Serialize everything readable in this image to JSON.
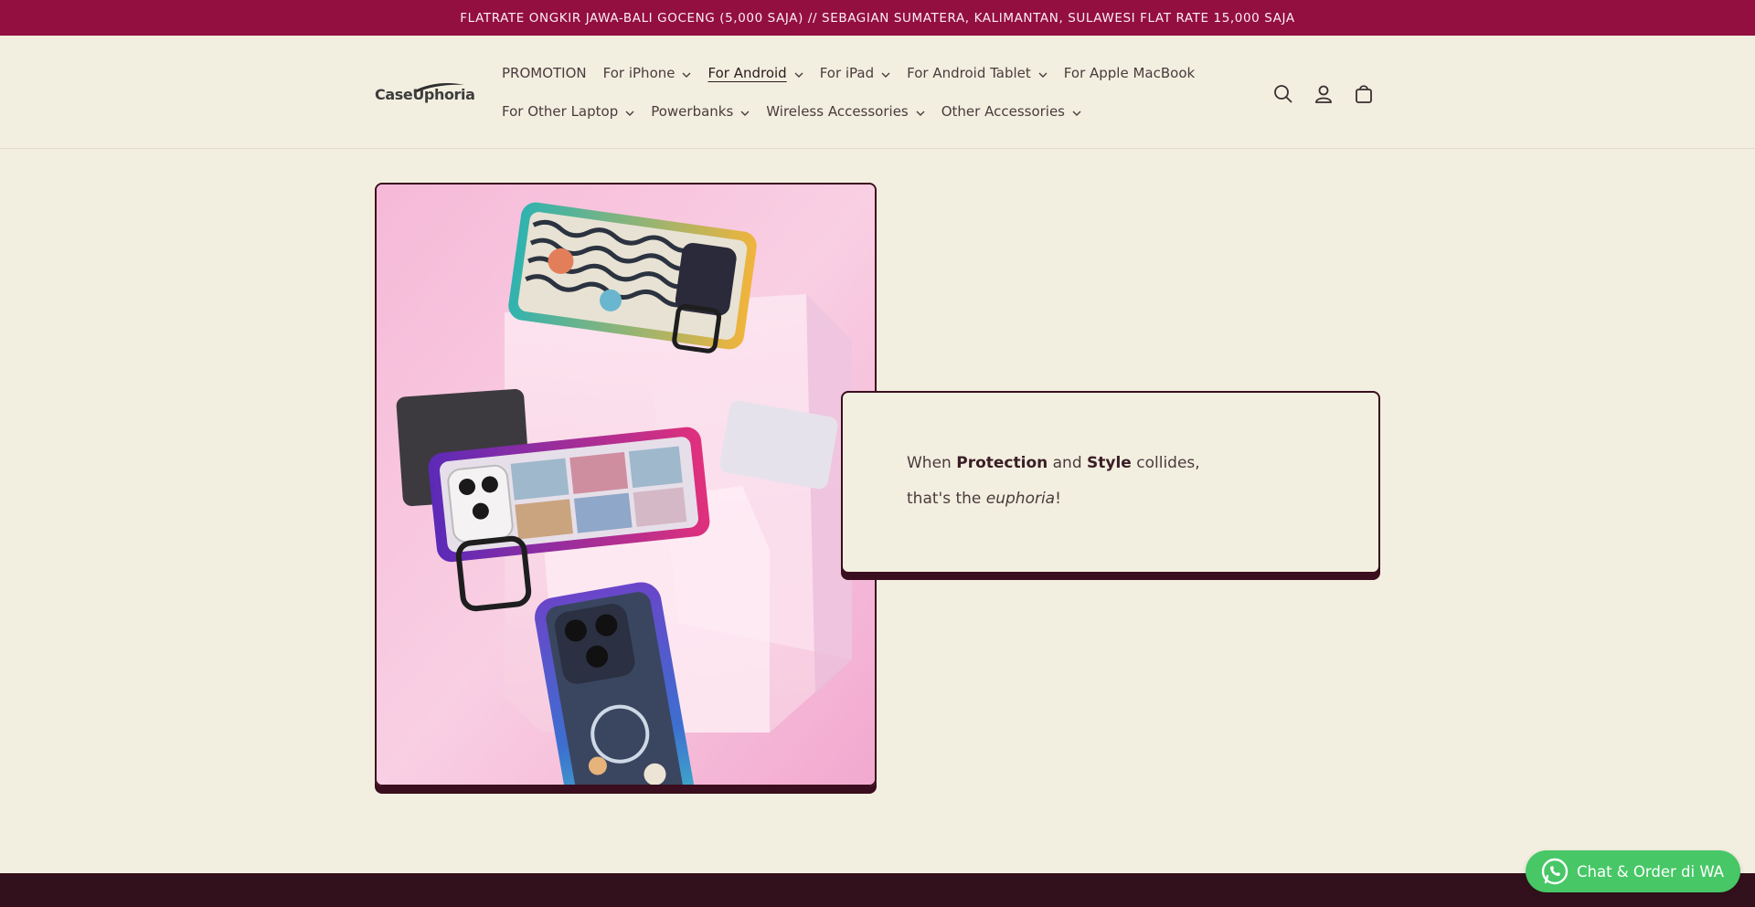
{
  "announcement": "FLATRATE ONGKIR JAWA-BALI GOCENG (5,000 SAJA) // SEBAGIAN SUMATERA, KALIMANTAN, SULAWESI FLAT RATE 15,000 SAJA",
  "logo": {
    "text": "CaseUphoria"
  },
  "nav": {
    "row1": [
      {
        "label": "PROMOTION",
        "dropdown": false,
        "active": false
      },
      {
        "label": "For iPhone",
        "dropdown": true,
        "active": false
      },
      {
        "label": "For Android",
        "dropdown": true,
        "active": true
      },
      {
        "label": "For iPad",
        "dropdown": true,
        "active": false
      },
      {
        "label": "For Android Tablet",
        "dropdown": true,
        "active": false
      },
      {
        "label": "For Apple MacBook",
        "dropdown": false,
        "active": false
      }
    ],
    "row2": [
      {
        "label": "For Other Laptop",
        "dropdown": true,
        "active": false
      },
      {
        "label": "Powerbanks",
        "dropdown": true,
        "active": false
      },
      {
        "label": "Wireless Accessories",
        "dropdown": true,
        "active": false
      },
      {
        "label": "Other Accessories",
        "dropdown": true,
        "active": false
      }
    ]
  },
  "header_icons": [
    "search-icon",
    "account-icon",
    "cart-icon"
  ],
  "hero": {
    "line1_pre": "When ",
    "line1_bold1": "Protection",
    "line1_mid": " and ",
    "line1_bold2": "Style",
    "line1_post": " collides,",
    "line2_pre": "that's the ",
    "line2_em": "euphoria",
    "line2_post": "!"
  },
  "whatsapp": {
    "label": "Chat & Order di WA"
  },
  "colors": {
    "announcement_bg": "#930f40",
    "page_bg": "#f3efe0",
    "border_dark": "#3a0e1e",
    "whatsapp_green": "#47c766",
    "footer_bg": "#33111c"
  }
}
